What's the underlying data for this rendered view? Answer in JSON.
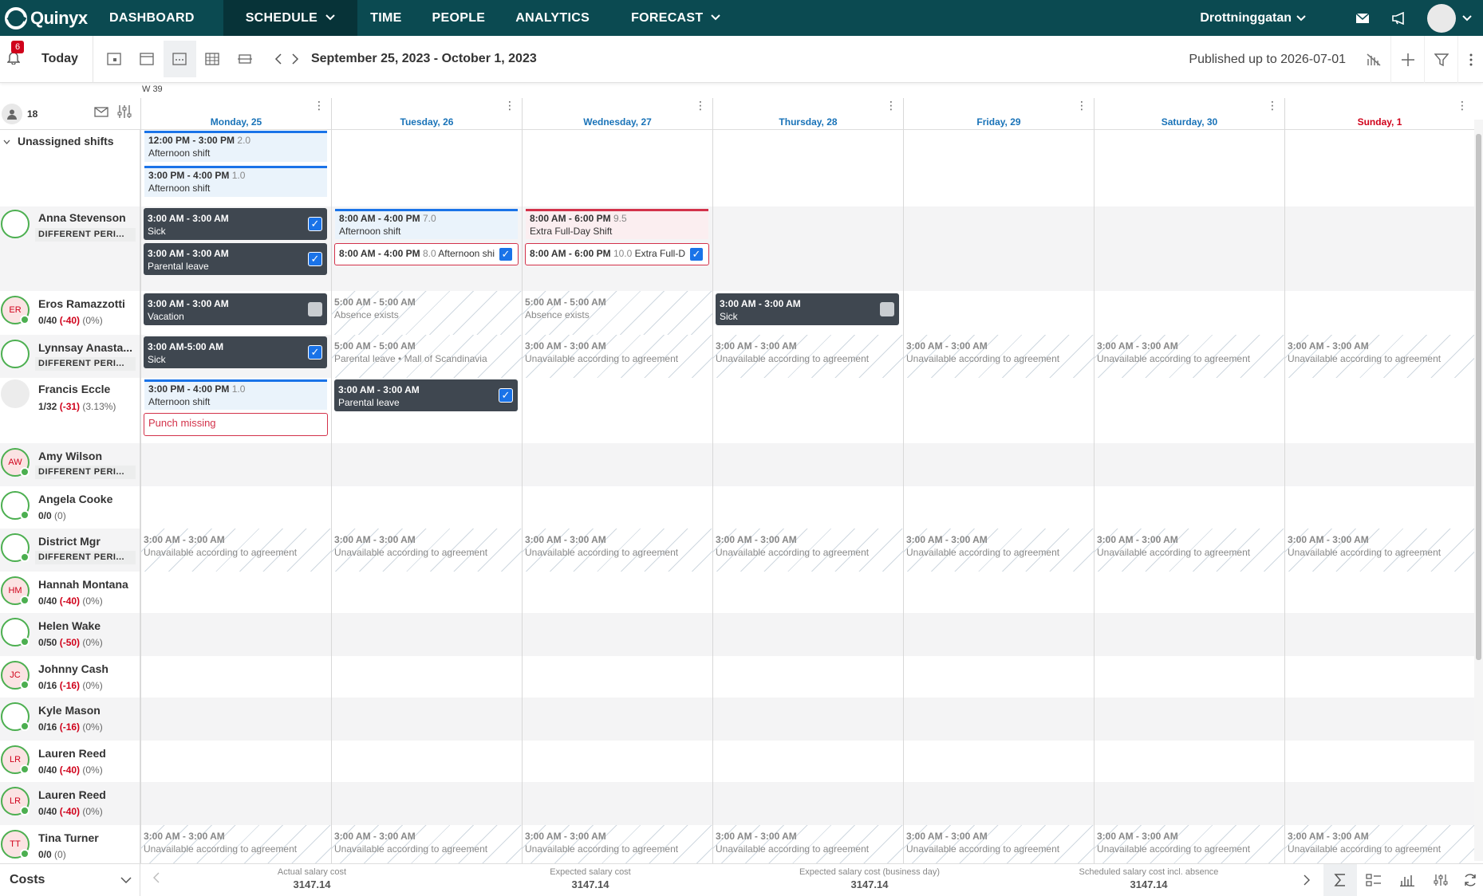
{
  "app": {
    "brand": "Quinyx"
  },
  "nav": {
    "items": [
      {
        "label": "DASHBOARD"
      },
      {
        "label": "SCHEDULE"
      },
      {
        "label": "TIME"
      },
      {
        "label": "PEOPLE"
      },
      {
        "label": "ANALYTICS"
      },
      {
        "label": "FORECAST"
      }
    ],
    "location": "Drottninggatan"
  },
  "toolbar": {
    "notifications": "6",
    "today": "Today",
    "range": "September 25, 2023 - October 1, 2023",
    "published": "Published up to 2026-07-01"
  },
  "grid": {
    "week": "W 39",
    "employee_count": "18",
    "days": [
      {
        "label": "Monday, 25"
      },
      {
        "label": "Tuesday, 26"
      },
      {
        "label": "Wednesday, 27"
      },
      {
        "label": "Thursday, 28"
      },
      {
        "label": "Friday, 29"
      },
      {
        "label": "Saturday, 30"
      },
      {
        "label": "Sunday, 1"
      }
    ],
    "unassigned": "Unassigned shifts"
  },
  "people": [
    {
      "name": "Anna Stevenson",
      "tag": "DIFFERENT PERI..."
    },
    {
      "name": "Eros Ramazzotti",
      "initials": "ER",
      "a": "0/40",
      "b": "(-40)",
      "c": "(0%)"
    },
    {
      "name": "Lynnsay Anasta...",
      "tag": "DIFFERENT PERI..."
    },
    {
      "name": "Francis Eccle",
      "a": "1/32",
      "b": "(-31)",
      "c": "(3.13%)"
    },
    {
      "name": "Amy Wilson",
      "initials": "AW",
      "tag": "DIFFERENT PERI..."
    },
    {
      "name": "Angela Cooke",
      "a": "0/0",
      "c": "(0)"
    },
    {
      "name": "District Mgr",
      "tag": "DIFFERENT PERI..."
    },
    {
      "name": "Hannah Montana",
      "initials": "HM",
      "a": "0/40",
      "b": "(-40)",
      "c": "(0%)"
    },
    {
      "name": "Helen Wake",
      "a": "0/50",
      "b": "(-50)",
      "c": "(0%)"
    },
    {
      "name": "Johnny Cash",
      "initials": "JC",
      "a": "0/16",
      "b": "(-16)",
      "c": "(0%)"
    },
    {
      "name": "Kyle Mason",
      "a": "0/16",
      "b": "(-16)",
      "c": "(0%)"
    },
    {
      "name": "Lauren Reed",
      "initials": "LR",
      "a": "0/40",
      "b": "(-40)",
      "c": "(0%)"
    },
    {
      "name": "Lauren Reed",
      "initials": "LR",
      "a": "0/40",
      "b": "(-40)",
      "c": "(0%)"
    },
    {
      "name": "Tina Turner",
      "initials": "TT",
      "a": "0/0",
      "c": "(0)"
    }
  ],
  "shifts": {
    "u1": {
      "time": "12:00 PM - 3:00 PM",
      "hrs": "2.0",
      "name": "Afternoon shift"
    },
    "u2": {
      "time": "3:00 PM - 4:00 PM",
      "hrs": "1.0",
      "name": "Afternoon shift"
    },
    "a1": {
      "time": "3:00 AM - 3:00 AM",
      "name": "Sick"
    },
    "a2": {
      "time": "3:00 AM - 3:00 AM",
      "name": "Parental leave"
    },
    "a3": {
      "time": "8:00 AM - 4:00 PM",
      "hrs": "7.0",
      "name": "Afternoon shift"
    },
    "a4": {
      "time": "8:00 AM - 4:00 PM",
      "hrs": "8.0",
      "name": "Afternoon shi"
    },
    "a5": {
      "time": "8:00 AM - 6:00 PM",
      "hrs": "9.5",
      "name": "Extra Full-Day Shift"
    },
    "a6": {
      "time": "8:00 AM - 6:00 PM",
      "hrs": "10.0",
      "name": "Extra Full-D"
    },
    "e1": {
      "time": "3:00 AM - 3:00 AM",
      "name": "Vacation"
    },
    "e2": {
      "time": "5:00 AM - 5:00 AM",
      "name": "Absence exists"
    },
    "e3": {
      "time": "5:00 AM - 5:00 AM",
      "name": "Absence exists"
    },
    "e4": {
      "time": "3:00 AM - 3:00 AM",
      "name": "Sick"
    },
    "l1": {
      "time": "3:00 AM-5:00 AM",
      "name": "Sick"
    },
    "l2": {
      "time": "5:00 AM - 5:00 AM",
      "name": "Parental leave • Mall of Scandinavia"
    },
    "f1": {
      "time": "3:00 PM - 4:00 PM",
      "hrs": "1.0",
      "name": "Afternoon shift"
    },
    "f2": {
      "text": "Punch missing"
    },
    "f3": {
      "time": "3:00 AM - 3:00 AM",
      "name": "Parental leave"
    },
    "unavail": {
      "time": "3:00 AM - 3:00 AM",
      "name": "Unavailable according to agreement"
    }
  },
  "footer": {
    "costs": "Costs",
    "metrics": [
      {
        "label": "Actual salary cost",
        "value": "3147.14"
      },
      {
        "label": "Expected salary cost",
        "value": "3147.14"
      },
      {
        "label": "Expected salary cost (business day)",
        "value": "3147.14"
      },
      {
        "label": "Scheduled salary cost incl. absence",
        "value": "3147.14"
      }
    ]
  },
  "colors": {
    "nav": "#0b4a51",
    "accent": "#1a73e8",
    "alert": "#d0021b"
  }
}
